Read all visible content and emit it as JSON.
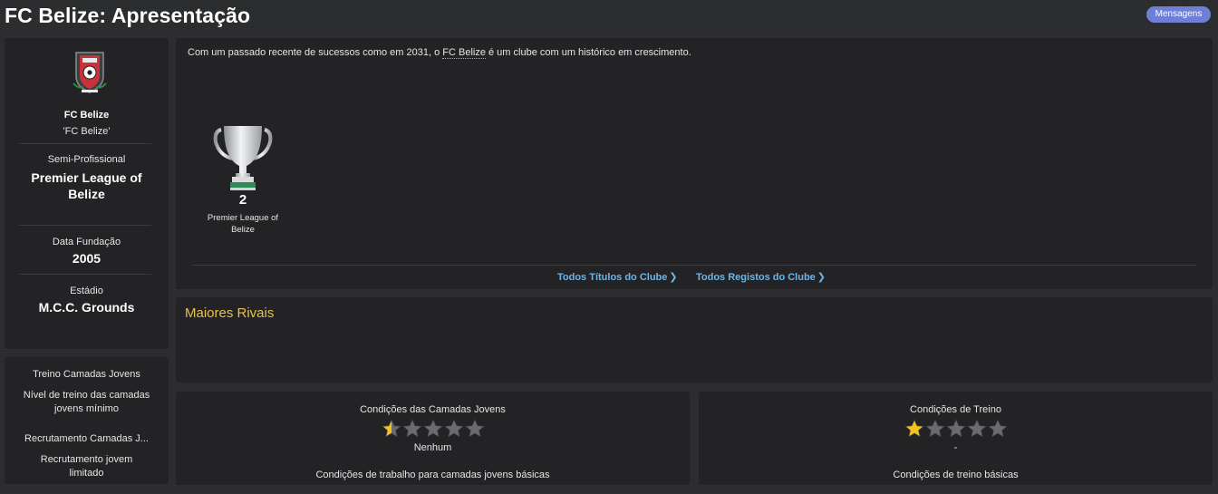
{
  "header": {
    "title": "FC Belize: Apresentação",
    "messages_button": "Mensagens"
  },
  "club": {
    "name": "FC Belize",
    "nickname": "'FC Belize'",
    "status": "Semi-Profissional",
    "league": "Premier League of Belize",
    "founded_label": "Data Fundação",
    "founded_value": "2005",
    "stadium_label": "Estádio",
    "stadium_value": "M.C.C. Grounds",
    "crest_icon": "club-crest-icon"
  },
  "youth": {
    "training_label": "Treino Camadas Jovens",
    "training_value": "Nível de treino das camadas jovens mínimo",
    "recruitment_label": "Recrutamento Camadas J...",
    "recruitment_value": "Recrutamento jovem limitado"
  },
  "overview": {
    "intro_before": "Com um passado recente de sucessos como em 2031, o ",
    "intro_link": "FC Belize",
    "intro_after": " é um clube com um histórico em crescimento.",
    "trophy": {
      "icon": "trophy-icon",
      "count": "2",
      "name": "Premier League of Belize"
    },
    "links": {
      "all_titles": "Todos Títulos do Clube",
      "all_records": "Todos Registos do Clube"
    }
  },
  "rivals": {
    "title": "Maiores Rivais"
  },
  "facilities": {
    "youth": {
      "title": "Condições das Camadas Jovens",
      "rating": 0.5,
      "max": 5,
      "value": "Nenhum",
      "description": "Condições de trabalho para camadas jovens básicas"
    },
    "training": {
      "title": "Condições de Treino",
      "rating": 1,
      "max": 5,
      "value": "-",
      "description": "Condições de treino básicas"
    }
  },
  "colors": {
    "accent": "#6f7fd6",
    "link": "#6cb4e8",
    "heading": "#e8c14a",
    "star": "#f4c21b"
  }
}
